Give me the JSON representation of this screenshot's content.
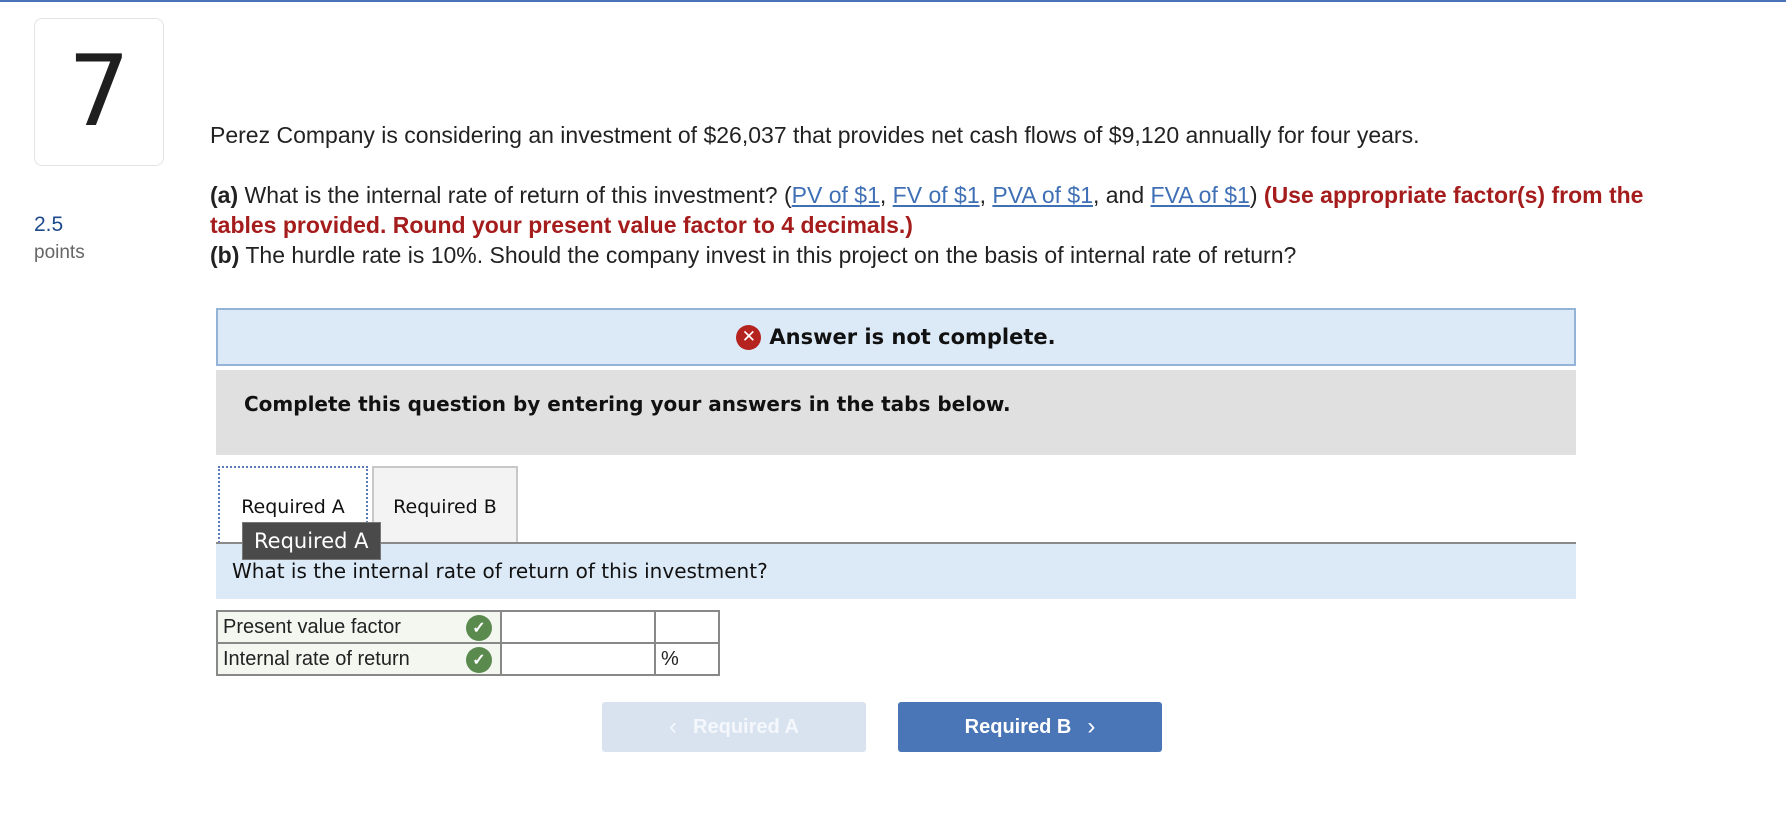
{
  "question": {
    "number": "7",
    "points_value": "2.5",
    "points_label": "points",
    "intro": "Perez Company is considering an investment of $26,037 that provides net cash flows of $9,120 annually for four years.",
    "part_a_label": "(a)",
    "part_a_text": " What is the internal rate of return of this investment? (",
    "links": [
      "PV of $1",
      "FV of $1",
      "PVA of $1",
      "FVA of $1"
    ],
    "sep_comma": ", ",
    "sep_and": ", and ",
    "close_paren": ") ",
    "part_a_instruction": "(Use appropriate factor(s) from the tables provided. Round your present value factor to 4 decimals.)",
    "part_b_label": "(b)",
    "part_b_text": " The hurdle rate is 10%. Should the company invest in this project on the basis of internal rate of return?"
  },
  "status": {
    "icon": "x-circle-icon",
    "message": "Answer is not complete."
  },
  "instruction": "Complete this question by entering your answers in the tabs below.",
  "tabs": [
    {
      "label": "Required A",
      "active": true
    },
    {
      "label": "Required B",
      "active": false
    }
  ],
  "tooltip": "Required A",
  "tab_question": "What is the internal rate of return of this investment?",
  "answer_rows": [
    {
      "label": "Present value factor",
      "status_icon": "check-icon",
      "value": "",
      "unit": ""
    },
    {
      "label": "Internal rate of return",
      "status_icon": "check-icon",
      "value": "",
      "unit": "%"
    }
  ],
  "nav": {
    "prev_label": "Required A",
    "next_label": "Required B"
  },
  "colors": {
    "accent": "#4a76b8",
    "error": "#b5231f",
    "success": "#5b8a4f",
    "instruction_red": "#a51c1c"
  }
}
